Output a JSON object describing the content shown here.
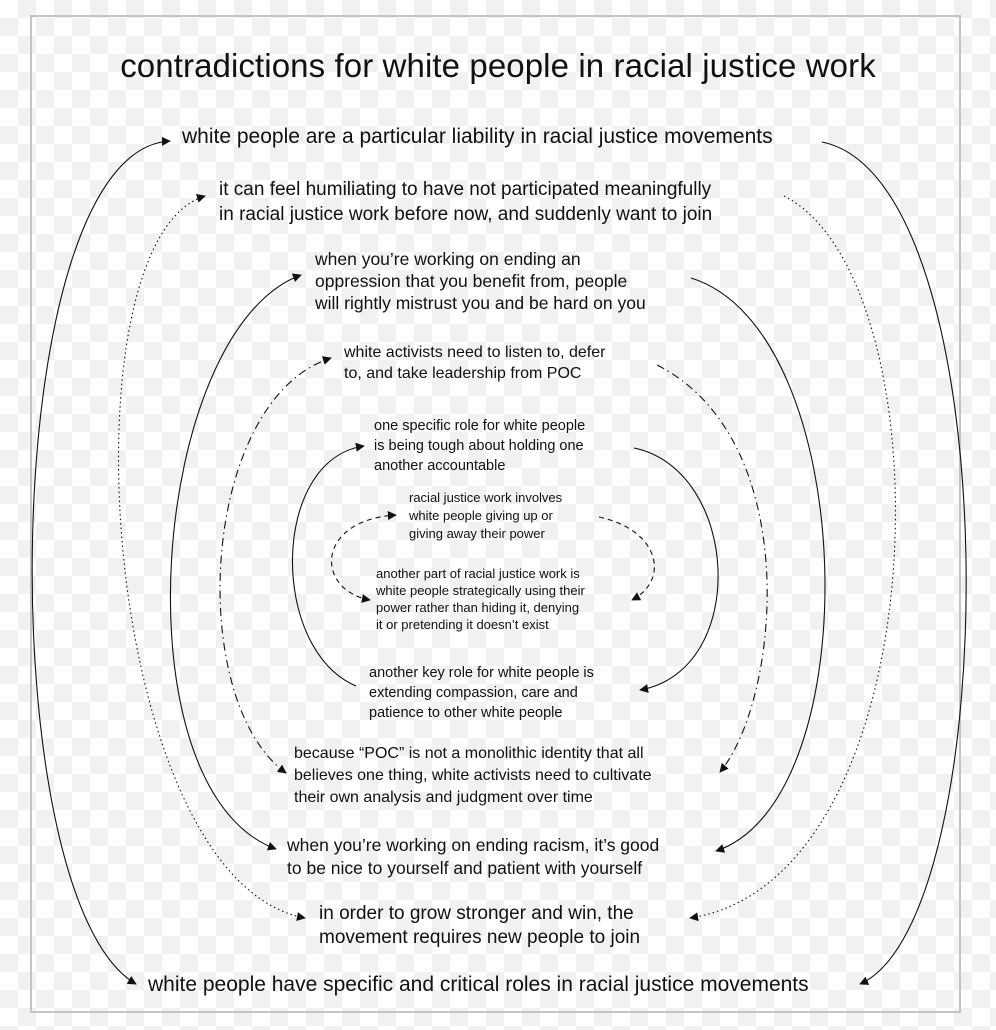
{
  "title": "contradictions for white people in racial justice work",
  "statements": {
    "s1": "white people are a particular liability in racial justice movements",
    "s2": "it can feel humiliating to have not participated meaningfully\nin racial justice work before now, and suddenly want to join",
    "s3": "when you’re working on ending an\noppression that you benefit from, people\nwill rightly mistrust you and be hard on you",
    "s4": "white activists need to listen to, defer\nto, and take leadership from POC",
    "s5": "one specific role for white people\nis being tough about holding one\nanother accountable",
    "s6": "racial justice work involves\nwhite people giving up or\ngiving away their power",
    "s7": "another part of racial justice work is\nwhite people strategically using their\npower rather than hiding it, denying\nit or pretending it doesn’t exist",
    "s8": "another key role for white people is\nextending compassion, care and\npatience to other white people",
    "s9": "because “POC” is not a monolithic identity that all\nbelieves one thing, white activists need to cultivate\ntheir own analysis and judgment over time",
    "s10": "when you’re working on ending racism, it’s good\nto be nice to yourself and patient with yourself",
    "s11": "in order to grow stronger and win, the\nmovement requires new people to join",
    "s12": "white people have specific and critical roles in racial justice movements"
  },
  "connectors": [
    {
      "pair": "1-12",
      "style": "solid"
    },
    {
      "pair": "2-11",
      "style": "dotted"
    },
    {
      "pair": "3-10",
      "style": "solid"
    },
    {
      "pair": "4-9",
      "style": "dash-dot"
    },
    {
      "pair": "5-8",
      "style": "solid"
    },
    {
      "pair": "6-7",
      "style": "dashed"
    }
  ],
  "colors": {
    "line": "#111111",
    "frame": "#c4c4c4",
    "checker": "#f1f1f1"
  }
}
